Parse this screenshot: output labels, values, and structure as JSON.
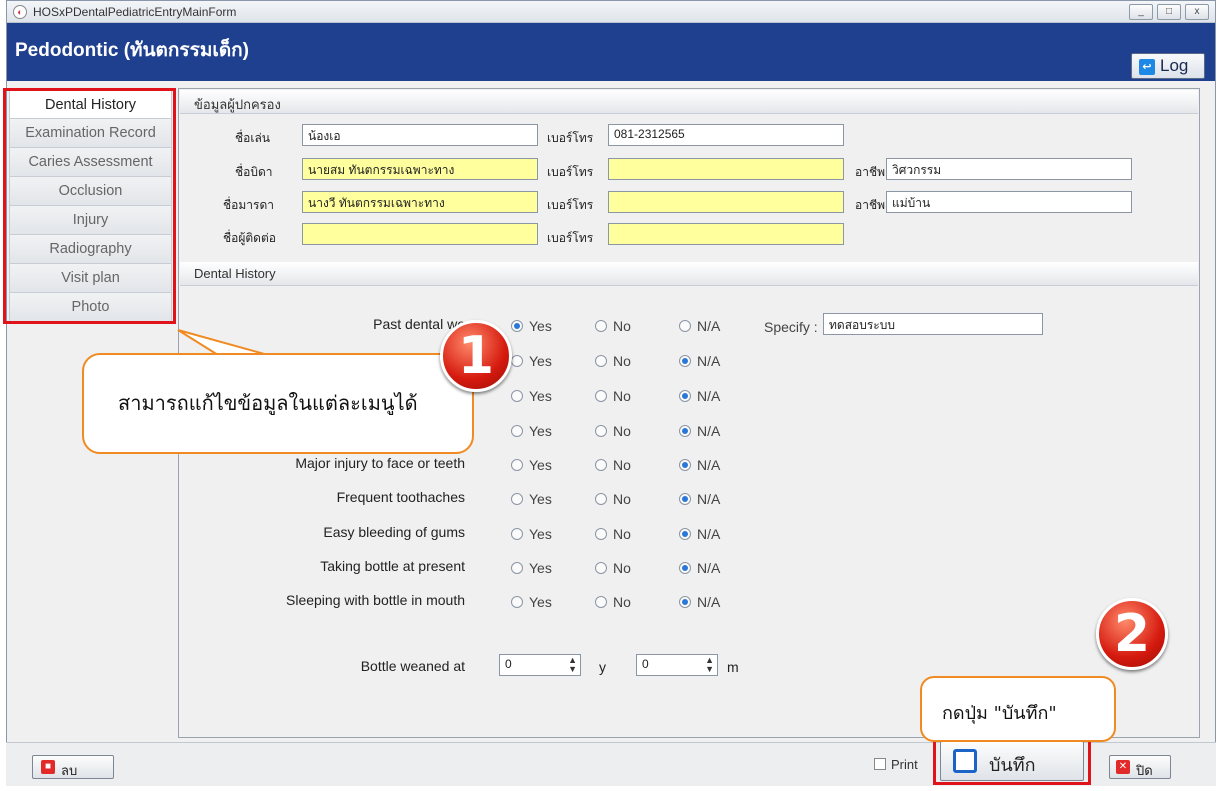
{
  "window": {
    "title": "HOSxPDentalPediatricEntryMainForm",
    "min_label": "_",
    "max_label": "□",
    "close_label": "x"
  },
  "header": {
    "title": "Pedodontic (ทันตกรรมเด็ก)",
    "log_label": "Log"
  },
  "nav": {
    "items": [
      {
        "label": "Dental History"
      },
      {
        "label": "Examination Record"
      },
      {
        "label": "Caries Assessment"
      },
      {
        "label": "Occlusion"
      },
      {
        "label": "Injury"
      },
      {
        "label": "Radiography"
      },
      {
        "label": "Visit plan"
      },
      {
        "label": "Photo"
      }
    ]
  },
  "guardian": {
    "section_title": "ข้อมูลผู้ปกครอง",
    "nickname_label": "ชื่อเล่น",
    "nickname_value": "น้องเอ",
    "phone_label": "เบอร์โทร",
    "nickname_phone": "081-2312565",
    "father_label": "ชื่อบิดา",
    "father_value": "นายสม ทันตกรรมเฉพาะทาง",
    "father_phone": "",
    "occupation_label": "อาชีพ",
    "father_occupation": "วิศวกรรม",
    "mother_label": "ชื่อมารดา",
    "mother_value": "นางวี ทันตกรรมเฉพาะทาง",
    "mother_phone": "",
    "mother_occupation": "แม่บ้าน",
    "contact_label": "ชื่อผู้ติดต่อ",
    "contact_value": "",
    "contact_phone": ""
  },
  "history": {
    "section_title": "Dental History",
    "specify_label": "Specify :",
    "specify_value": "ทดสอบระบบ",
    "opt_yes": "Yes",
    "opt_no": "No",
    "opt_na": "N/A",
    "questions": [
      {
        "label": "Past dental wo",
        "selected": "yes"
      },
      {
        "label": "",
        "selected": "na"
      },
      {
        "label": "",
        "selected": "na"
      },
      {
        "label": "",
        "selected": "na"
      },
      {
        "label": "Major injury to face or teeth",
        "selected": "na"
      },
      {
        "label": "Frequent toothaches",
        "selected": "na"
      },
      {
        "label": "Easy bleeding of gums",
        "selected": "na"
      },
      {
        "label": "Taking bottle at present",
        "selected": "na"
      },
      {
        "label": "Sleeping with bottle in mouth",
        "selected": "na"
      }
    ],
    "weaned_label": "Bottle weaned at",
    "weaned_years": "0",
    "years_unit": "y",
    "weaned_months": "0",
    "months_unit": "m"
  },
  "bottom": {
    "delete_label": "ลบ",
    "print_label": "Print",
    "save_label": "บันทึก",
    "close_label": "ปิด"
  },
  "annotations": {
    "callout1_text": "สามารถแก้ไขข้อมูลในแต่ละเมนูได้",
    "callout2_text": "กดปุ่ม \"บันทึก\"",
    "badge1": "1",
    "badge2": "2"
  },
  "colors": {
    "header_bg": "#1f3f8f",
    "highlight_border": "#e0121a",
    "callout_border": "#f08a22",
    "required_field": "#ffff9e"
  }
}
